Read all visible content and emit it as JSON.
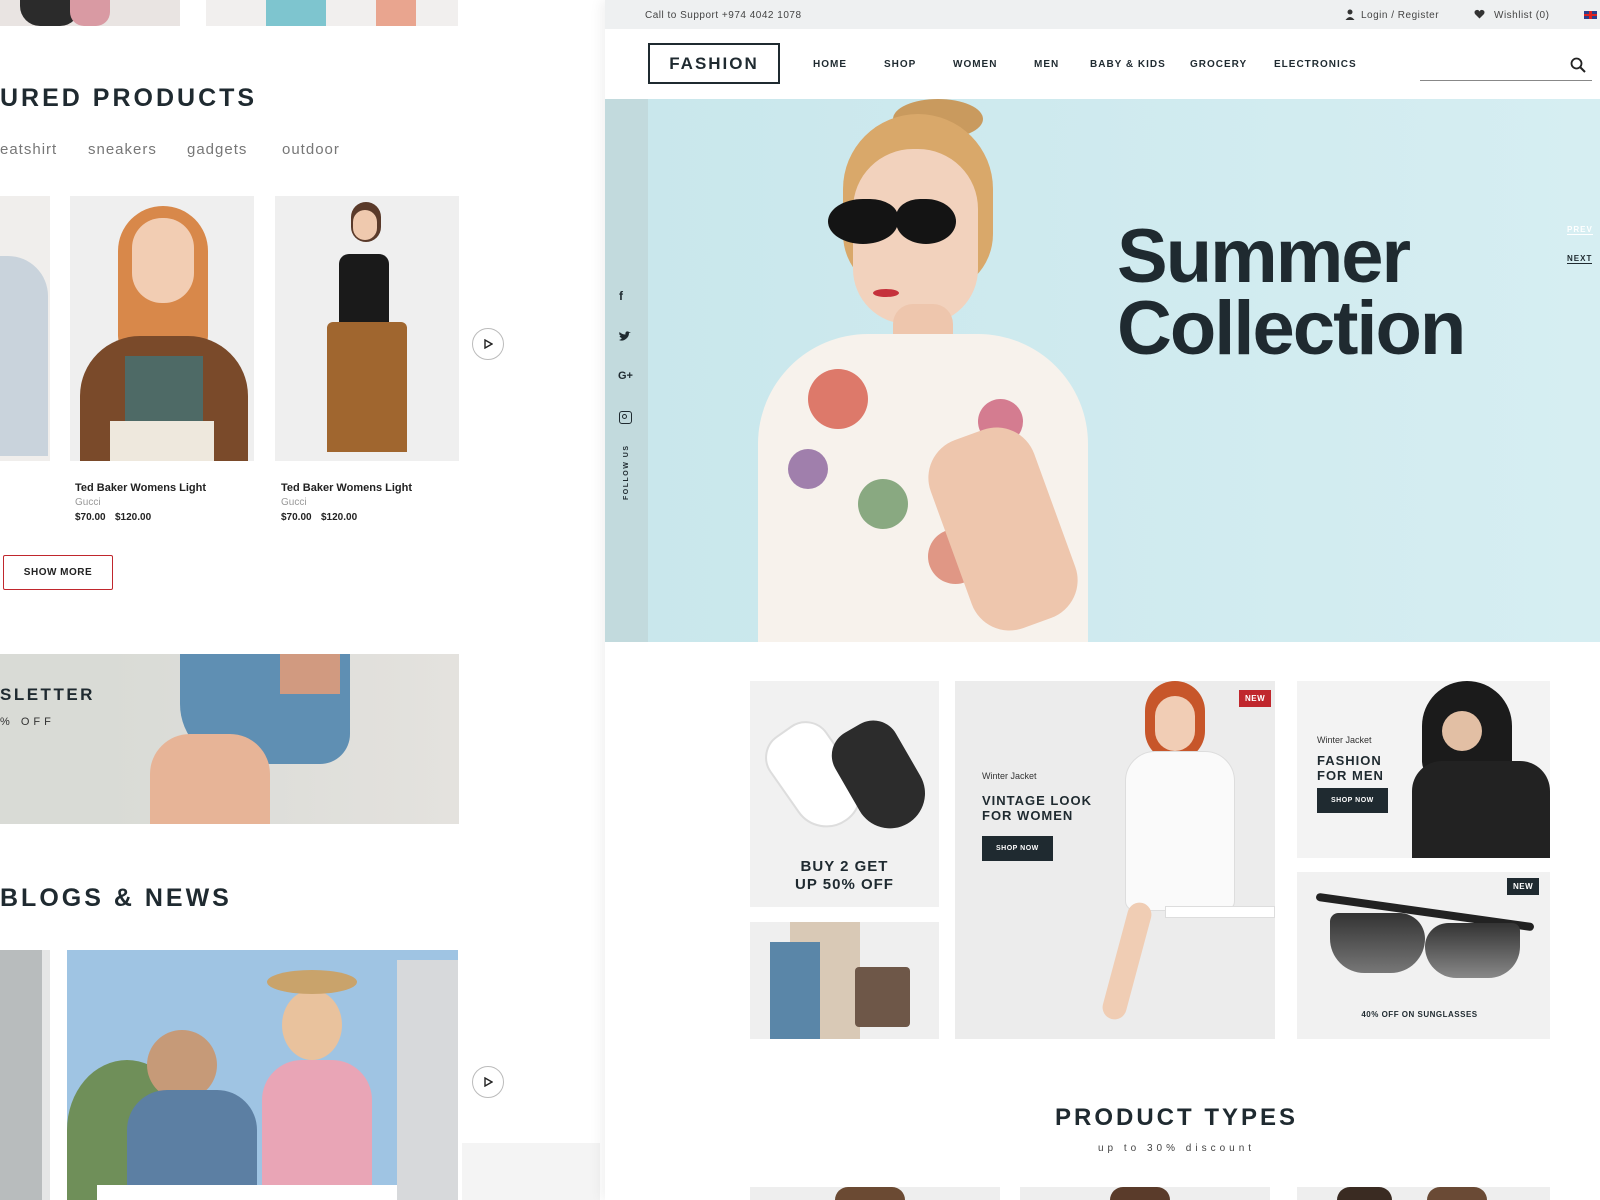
{
  "left": {
    "featured_title": "URED PRODUCTS",
    "categories": [
      "eatshirt",
      "sneakers",
      "gadgets",
      "outdoor"
    ],
    "products": [
      {
        "name": "Ted Baker Womens Light",
        "brand": "Gucci",
        "price": "$70.00",
        "old_price": "$120.00"
      },
      {
        "name": "Ted Baker Womens Light",
        "brand": "Gucci",
        "price": "$70.00",
        "old_price": "$120.00"
      }
    ],
    "show_more": "SHOW MORE",
    "newsletter_title": "SLETTER",
    "newsletter_sub": "% OFF",
    "blogs_title": "BLOGS & NEWS"
  },
  "topbar": {
    "support": "Call to Support +974 4042 1078",
    "login": "Login / Register",
    "wishlist": "Wishlist (0)"
  },
  "nav": {
    "logo": "FASHION",
    "links": [
      "HOME",
      "SHOP",
      "WOMEN",
      "MEN",
      "BABY & KIDS",
      "GROCERY",
      "ELECTRONICS"
    ]
  },
  "hero": {
    "line1": "Summer",
    "line2": "Collection",
    "prev": "PREV",
    "next": "NEXT",
    "follow": "FOLLOW US"
  },
  "tiles": {
    "sneaker_text1": "BUY 2 GET",
    "sneaker_text2": "UP 50% OFF",
    "women_kicker": "Winter Jacket",
    "women_title1": "VINTAGE LOOK",
    "women_title2": "FOR WOMEN",
    "women_btn": "SHOP NOW",
    "women_badge": "NEW",
    "men_kicker": "Winter Jacket",
    "men_title1": "FASHION",
    "men_title2": "FOR MEN",
    "men_btn": "SHOP NOW",
    "glasses_badge": "NEW",
    "glasses_text": "40% OFF ON SUNGLASSES"
  },
  "product_types": {
    "title": "PRODUCT TYPES",
    "sub": "up to 30% discount"
  },
  "colors": {
    "dark": "#1f2a30",
    "accent": "#c0272d",
    "hero_bg": "#cfe6ea"
  }
}
